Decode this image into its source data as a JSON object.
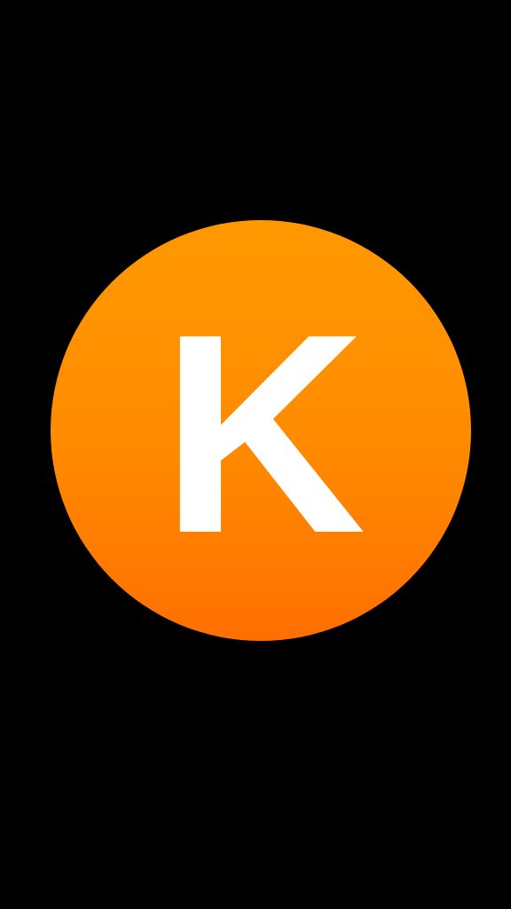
{
  "splash": {
    "logo_letter": "K",
    "colors": {
      "background": "#000000",
      "logo_gradient_top": "#ff9900",
      "logo_gradient_bottom": "#ff6f00",
      "letter": "#ffffff"
    }
  }
}
